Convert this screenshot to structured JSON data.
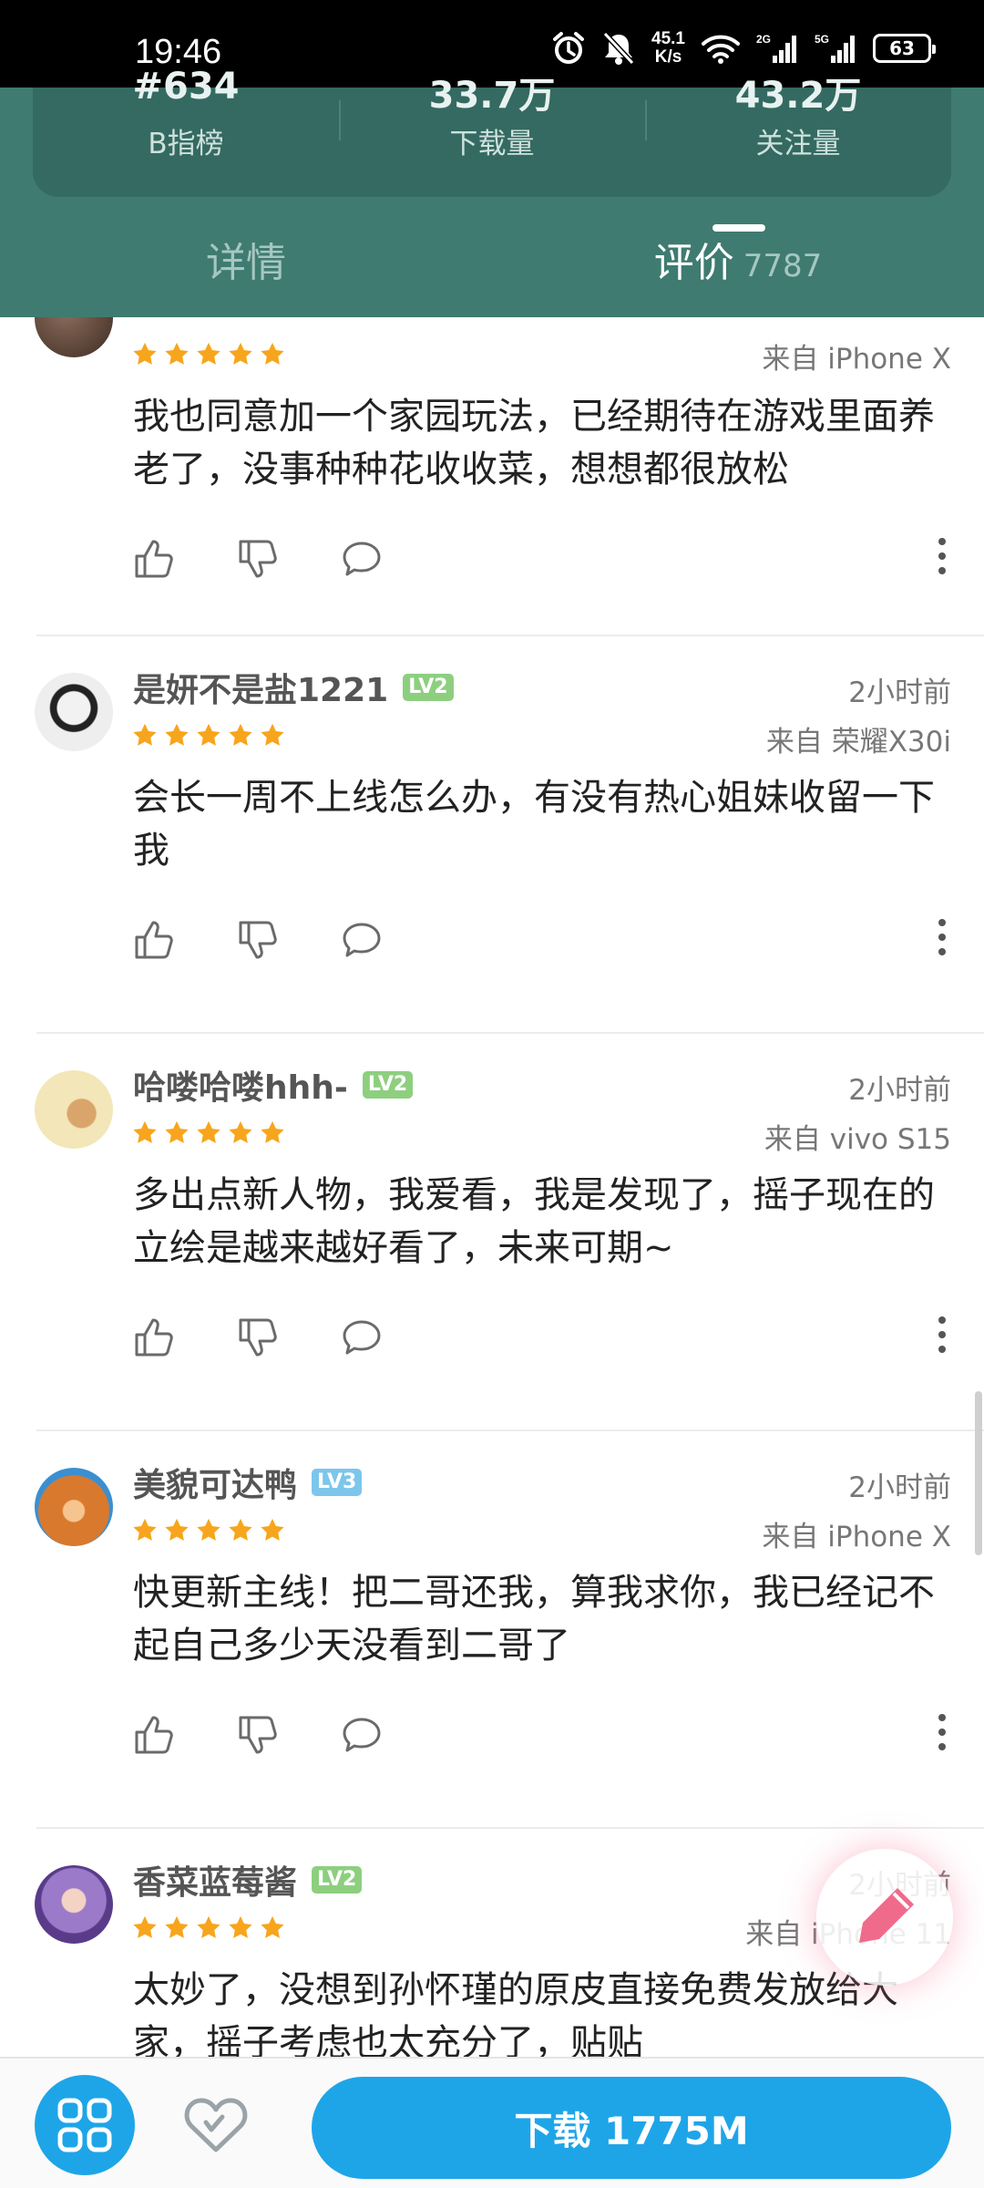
{
  "status_bar": {
    "time": "19:46",
    "net_speed_value": "45.1",
    "net_speed_unit": "K/s",
    "signal_1": "2G",
    "signal_2": "5G",
    "battery": "63"
  },
  "stats": [
    {
      "value": "#634",
      "label": "B指榜"
    },
    {
      "value": "33.7万",
      "label": "下载量"
    },
    {
      "value": "43.2万",
      "label": "关注量"
    }
  ],
  "tabs": {
    "details": "详情",
    "reviews": "评价",
    "reviews_count": "7787"
  },
  "colors": {
    "header_bg": "#3f7b71",
    "accent_blue": "#1ea5e8",
    "star": "#f7a51c",
    "lv2": "#8dcf7f",
    "lv3": "#7cc6ec",
    "fab_pink": "#f06a8c"
  },
  "reviews": [
    {
      "user": "",
      "level": "",
      "time": "",
      "device": "来自 iPhone X",
      "rating": 5,
      "content": "我也同意加一个家园玩法，已经期待在游戏里面养老了，没事种种花收收菜，想想都很放松"
    },
    {
      "user": "是妍不是盐1221",
      "level": "LV2",
      "time": "2小时前",
      "device": "来自 荣耀X30i",
      "rating": 5,
      "content": "会长一周不上线怎么办，有没有热心姐妹收留一下我"
    },
    {
      "user": "哈喽哈喽hhh-",
      "level": "LV2",
      "time": "2小时前",
      "device": "来自 vivo S15",
      "rating": 5,
      "content": "多出点新人物，我爱看，我是发现了，摇子现在的立绘是越来越好看了，未来可期~"
    },
    {
      "user": "美貌可达鸭",
      "level": "LV3",
      "time": "2小时前",
      "device": "来自 iPhone X",
      "rating": 5,
      "content": "快更新主线！把二哥还我，算我求你，我已经记不起自己多少天没看到二哥了"
    },
    {
      "user": "香菜蓝莓酱",
      "level": "LV2",
      "time": "2小时前",
      "device": "来自 iPhone 11",
      "rating": 5,
      "content": "太妙了，没想到孙怀瑾的原皮直接免费发放给大家，摇子考虑也太充分了，贴贴"
    }
  ],
  "bottom_bar": {
    "download_label": "下载 1775M"
  },
  "icons": [
    "alarm-icon",
    "mute-icon",
    "wifi-icon",
    "signal-icon",
    "battery-icon",
    "thumb-up-icon",
    "thumb-down-icon",
    "comment-icon",
    "more-icon",
    "edit-icon",
    "grid-icon",
    "heart-icon"
  ]
}
